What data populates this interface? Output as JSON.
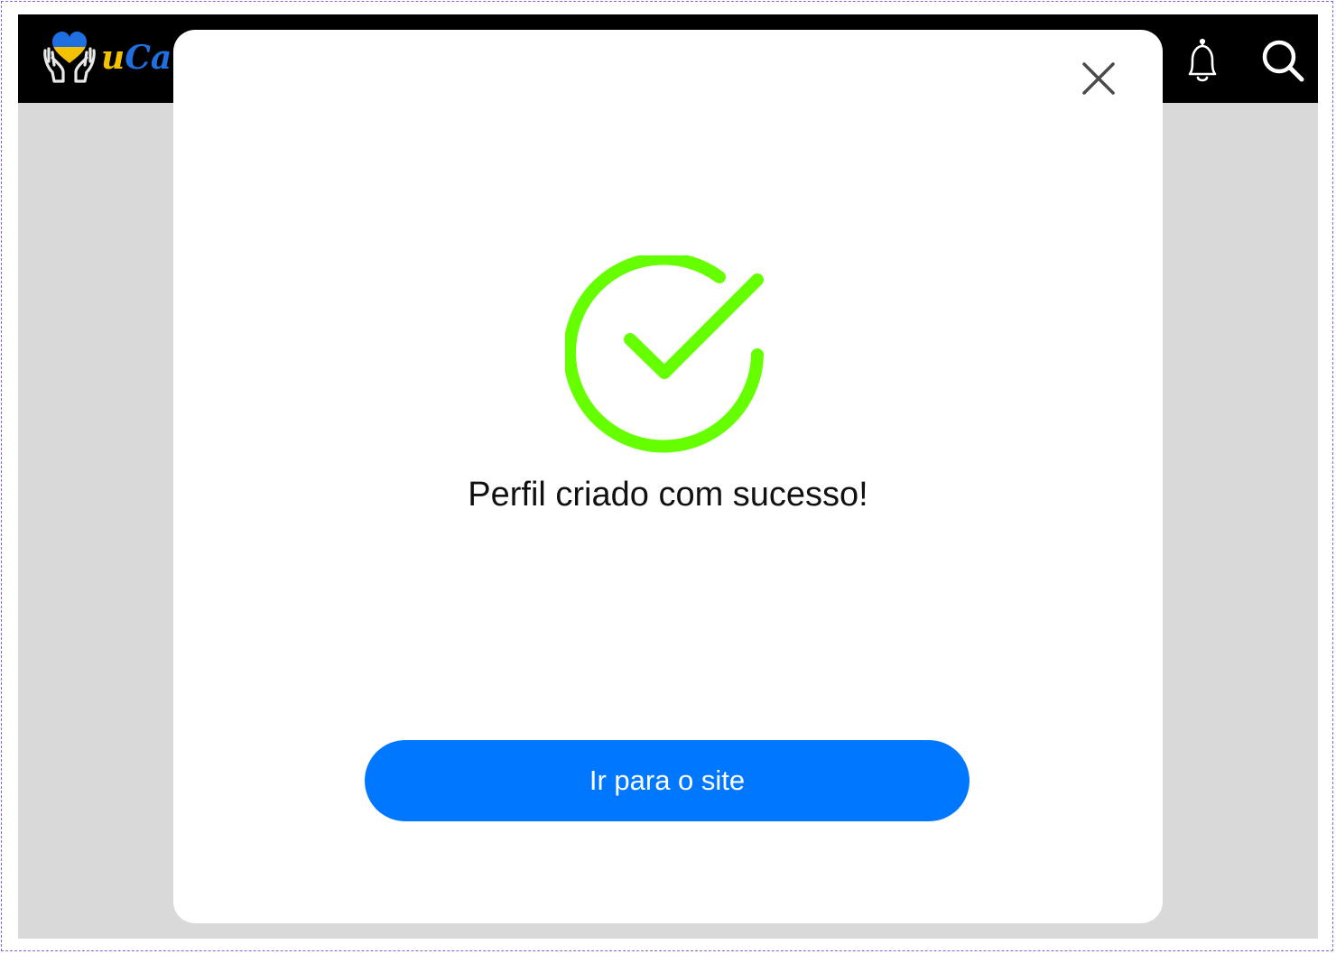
{
  "header": {
    "logo_prefix": "u",
    "logo_rest": "Car",
    "icons": [
      "heart-hands-logo-icon",
      "bell-icon",
      "search-icon"
    ]
  },
  "modal": {
    "close_icon": "close-icon",
    "status_icon": "check-circle-icon",
    "message": "Perfil criado com sucesso!",
    "button_label": "Ir para o site"
  },
  "colors": {
    "topbar": "#000000",
    "backdrop": "#d9d9d9",
    "success": "#66ff00",
    "primary": "#0077ff",
    "logo_yellow": "#f2c200",
    "logo_blue": "#1f6fe0"
  }
}
